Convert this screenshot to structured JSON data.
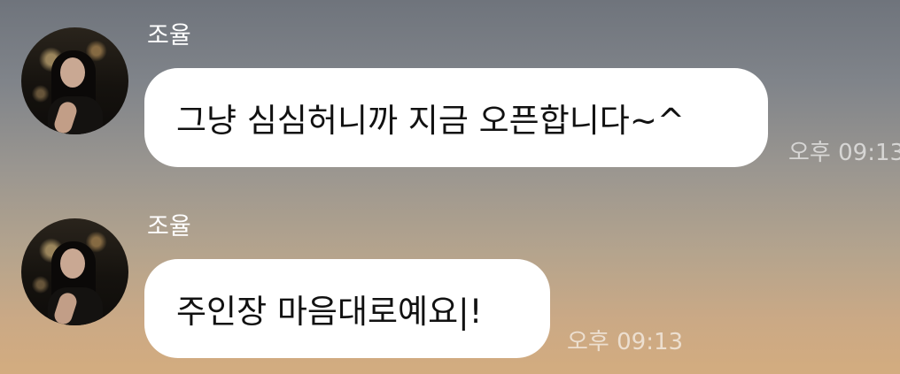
{
  "messages": [
    {
      "sender": "조율",
      "text": "그냥 심심허니까 지금 오픈합니다~^",
      "time": "오후 09:13"
    },
    {
      "sender": "조율",
      "text": "주인장 마음대로예요|!",
      "time": "오후 09:13"
    }
  ]
}
